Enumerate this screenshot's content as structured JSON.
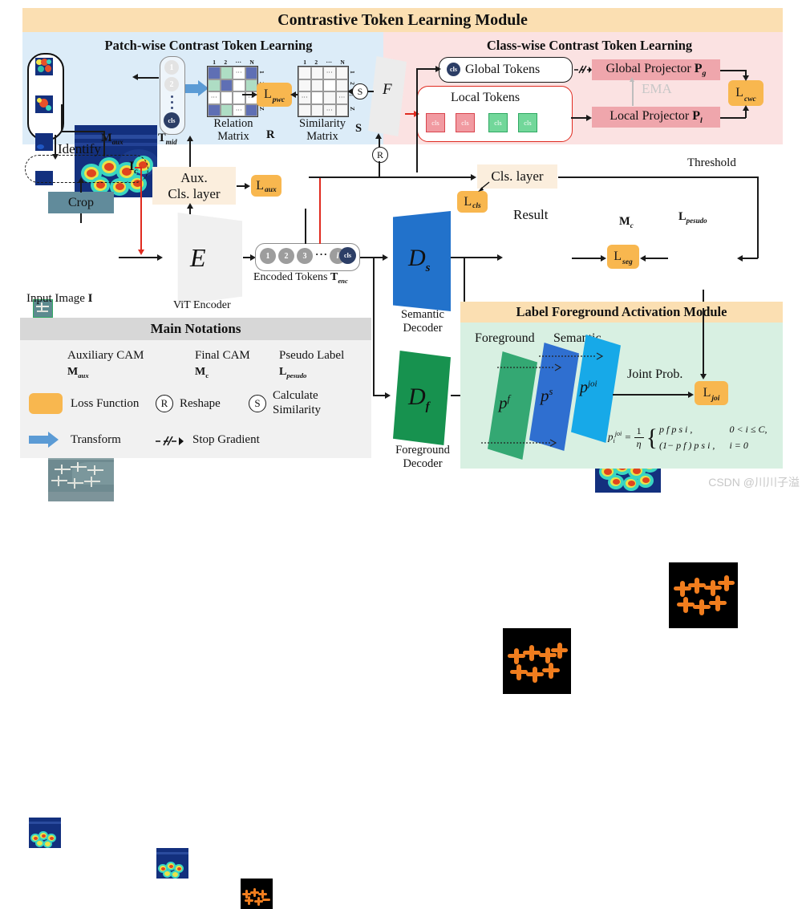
{
  "modules": {
    "ctl": {
      "title": "Contrastive Token Learning Module",
      "patchwise": {
        "title": "Patch-wise Contrast Token Learning",
        "aux_cam_label": "M",
        "aux_cam_sub": "aux",
        "tmid_label": "T",
        "tmid_sub": "mid",
        "relation_matrix_label": "Relation\nMatrix",
        "relation_matrix_line1": "Relation",
        "relation_matrix_line2": "Matrix",
        "relation_matrix_symbol": "R",
        "similarity_matrix_line1": "Similarity",
        "similarity_matrix_line2": "Matrix",
        "similarity_matrix_symbol": "S",
        "matrix_col_headers": [
          "1",
          "2",
          "···",
          "N"
        ],
        "matrix_row_headers": [
          "1",
          "2",
          "⋮",
          "Z"
        ],
        "loss_pwc": "L",
        "loss_pwc_sub": "pwc",
        "feature_symbol": "F",
        "similarity_op": "S",
        "reshape_op": "R",
        "token_items": [
          "1",
          "2",
          "cls"
        ]
      },
      "classwise": {
        "title": "Class-wise Contrast Token Learning",
        "global_tokens": "Global Tokens",
        "local_tokens": "Local Tokens",
        "global_projector": "Global Projector",
        "global_projector_sym": "P",
        "global_projector_sub": "g",
        "local_projector": "Local  Projector",
        "local_projector_sym": "P",
        "local_projector_sub": "l",
        "ema": "EMA",
        "loss_cwc": "L",
        "loss_cwc_sub": "cwc",
        "cls_chips": [
          "cls",
          "cls",
          "cls",
          "cls"
        ]
      }
    },
    "lfa": {
      "title": "Label Foreground Activation Module",
      "foreground_label": "Foreground",
      "semantic_label": "Semantic",
      "plane_f": "p",
      "plane_f_sup": "f",
      "plane_s": "p",
      "plane_s_sup": "s",
      "plane_joi": "p",
      "plane_joi_sup": "joi",
      "joint_prob": "Joint Prob.",
      "loss_joi": "L",
      "loss_joi_sub": "joi",
      "formula_lhs": "p",
      "formula_lhs_sub": "i",
      "formula_lhs_sup": "joi",
      "formula_eq": "=",
      "formula_frac_num": "1",
      "formula_frac_den": "η",
      "formula_case1": "p f p s i ,",
      "formula_case1_cond": "0 < i ≤ C,",
      "formula_case2": "(1− p f ) p s i ,",
      "formula_case2_cond": "i = 0"
    }
  },
  "pipeline": {
    "input_image_label": "Input Image",
    "input_image_sym": "I",
    "crop": "Crop",
    "identify": "Identify",
    "crops_symbol": "I",
    "crops_symbol_sub": "c",
    "encoder_symbol": "E",
    "encoder_label": "ViT Encoder",
    "aux_cls_layer_line1": "Aux.",
    "aux_cls_layer_line2": "Cls. layer",
    "loss_aux": "L",
    "loss_aux_sub": "aux",
    "encoded_tokens_label": "Encoded Tokens",
    "encoded_tokens_sym": "T",
    "encoded_tokens_sub": "enc",
    "encoded_token_items": [
      "1",
      "2",
      "3",
      "···",
      "l",
      "cls"
    ],
    "semantic_decoder_sym": "D",
    "semantic_decoder_sub": "s",
    "semantic_decoder_line1": "Semantic",
    "semantic_decoder_line2": "Decoder",
    "foreground_decoder_sym": "D",
    "foreground_decoder_sub": "f",
    "foreground_decoder_line1": "Foreground",
    "foreground_decoder_line2": "Decoder",
    "cls_layer": "Cls. layer",
    "loss_cls": "L",
    "loss_cls_sub": "cls",
    "final_cam_sym": "M",
    "final_cam_sub": "c",
    "threshold": "Threshold",
    "pseudo_label_sym": "L",
    "pseudo_label_sub": "pesudo",
    "result_label": "Result",
    "loss_seg": "L",
    "loss_seg_sub": "seg"
  },
  "notations": {
    "title": "Main Notations",
    "items": [
      {
        "label": "Auxiliary CAM",
        "symbol": "M",
        "symbol_sub": "aux",
        "icon": "aux-cam-thumbnail"
      },
      {
        "label": "Final CAM",
        "symbol": "M",
        "symbol_sub": "c",
        "icon": "final-cam-thumbnail"
      },
      {
        "label": "Pseudo Label",
        "symbol": "L",
        "symbol_sub": "pesudo",
        "icon": "pseudo-label-thumbnail"
      },
      {
        "label": "Loss Function",
        "icon": "orange-rounded-box"
      },
      {
        "label": "Reshape",
        "icon": "circled-R"
      },
      {
        "label": "Calculate Similarity",
        "label_line1": "Calculate",
        "label_line2": "Similarity",
        "icon": "circled-S"
      },
      {
        "label": "Transform",
        "icon": "blue-arrow"
      },
      {
        "label": "Stop Gradient",
        "icon": "crossed-dashed-arrow"
      }
    ]
  },
  "watermark": "CSDN @川川子溢",
  "colors": {
    "ctl_title_bg": "#fbdfb2",
    "patchwise_bg": "#dcecf8",
    "classwise_bg": "#fbe2e2",
    "lfa_bg": "#d8f0e2",
    "notations_bg": "#f1f1f1",
    "loss_box": "#f8b74f",
    "projector": "#efa6ac",
    "semantic_decoder": "#2272cb",
    "foreground_decoder": "#17924f",
    "plane_joi": "#17a9e8",
    "red_arrow": "#e02b20",
    "transform_arrow": "#5b9bd5",
    "cls_token": "#2c3e66",
    "pseudo_fg": "#f07d1e"
  }
}
